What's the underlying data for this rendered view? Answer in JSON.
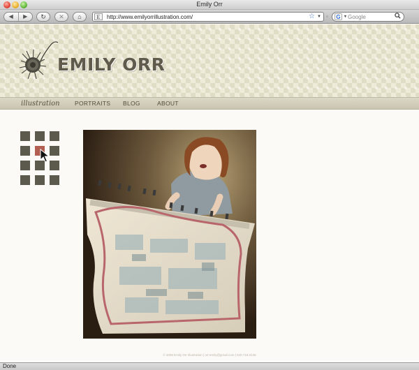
{
  "window": {
    "title": "Emily Orr"
  },
  "toolbar": {
    "back_icon": "◀",
    "forward_icon": "▶",
    "reload_icon": "↻",
    "stop_icon": "✕",
    "home_icon": "⌂",
    "favicon_letter": "E",
    "url": "http://www.emilyorrillustration.com/",
    "bookmark_star": "☆",
    "url_dropdown": "▼",
    "search_engine_letter": "G",
    "search_placeholder": "Google",
    "search_icon": "🔍"
  },
  "site": {
    "name": "EMILY ORR",
    "tagline": "illustration",
    "nav": {
      "portraits": "PORTRAITS",
      "blog": "BLOG",
      "about": "ABOUT"
    },
    "gallery": {
      "thumbnail_count": 12,
      "selected_index": 4
    },
    "footer": "© 2008 Emily Orr Illustration | orr.emily@gmail.com | 540.719.0136"
  },
  "statusbar": {
    "text": "Done"
  },
  "colors": {
    "header_bg": "#eeebd9",
    "nav_bg": "#d3cfbc",
    "thumb": "#5b5a4d",
    "thumb_active": "#b25f52",
    "title_text": "#5f5a4c"
  }
}
